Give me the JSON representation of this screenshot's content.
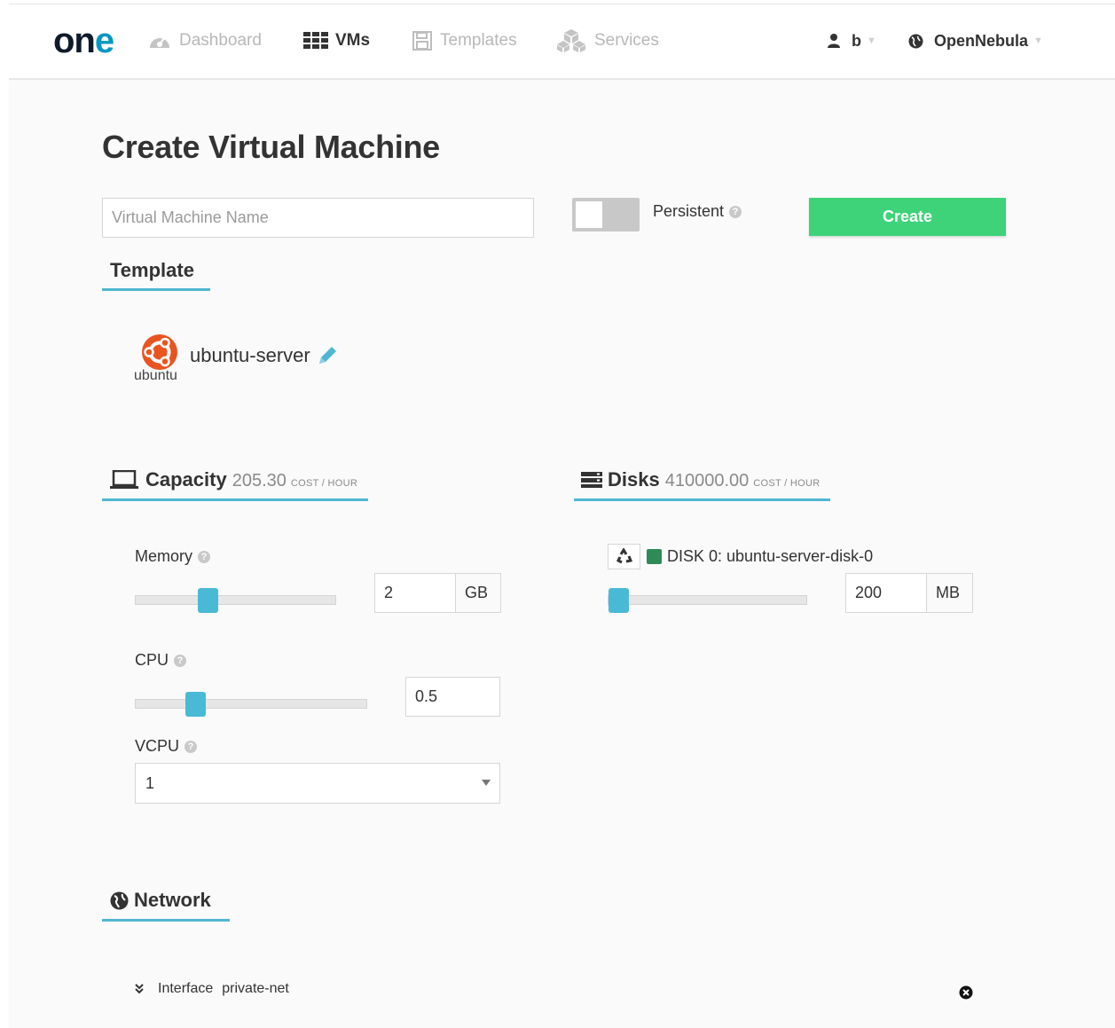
{
  "header": {
    "logo_text": "one",
    "nav": [
      {
        "label": "Dashboard",
        "icon": "dashboard-icon",
        "active": false
      },
      {
        "label": "VMs",
        "icon": "grid-icon",
        "active": true
      },
      {
        "label": "Templates",
        "icon": "save-icon",
        "active": false
      },
      {
        "label": "Services",
        "icon": "cubes-icon",
        "active": false
      }
    ],
    "user_label": "b",
    "zone_label": "OpenNebula"
  },
  "page_title": "Create Virtual Machine",
  "form": {
    "vm_name_placeholder": "Virtual Machine Name",
    "vm_name_value": "",
    "persistent_label": "Persistent",
    "persistent_on": false,
    "create_label": "Create"
  },
  "template": {
    "heading": "Template",
    "os_logo_text": "ubuntu",
    "name": "ubuntu-server"
  },
  "capacity": {
    "heading": "Capacity",
    "cost": "205.30",
    "cost_unit": "COST / HOUR",
    "memory_label": "Memory",
    "memory_value": "2",
    "memory_unit": "GB",
    "memory_slider_fraction": 0.35,
    "cpu_label": "CPU",
    "cpu_value": "0.5",
    "cpu_slider_fraction": 0.24,
    "vcpu_label": "VCPU",
    "vcpu_value": "1"
  },
  "disks": {
    "heading": "Disks",
    "cost": "410000.00",
    "cost_unit": "COST / HOUR",
    "disk_label": "DISK 0: ubuntu-server-disk-0",
    "disk_status_color": "#2e8b57",
    "disk_value": "200",
    "disk_unit": "MB",
    "disk_slider_fraction": 0.0
  },
  "network": {
    "heading": "Network",
    "interface_label": "Interface",
    "interface_name": "private-net"
  },
  "colors": {
    "accent": "#4fb7d2",
    "create_button": "#3ed379"
  }
}
